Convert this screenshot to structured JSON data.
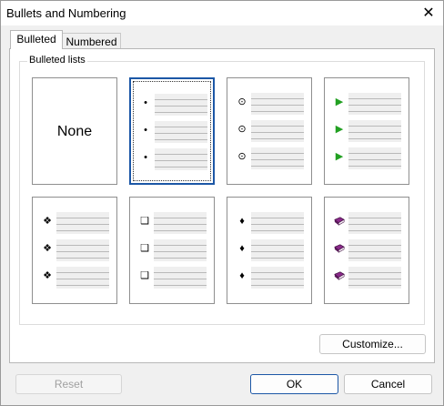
{
  "window": {
    "title": "Bullets and Numbering",
    "close_symbol": "✕"
  },
  "tabs": [
    {
      "label": "Bulleted",
      "active": true
    },
    {
      "label": "Numbered",
      "active": false
    }
  ],
  "group": {
    "label": "Bulleted lists",
    "styles": [
      {
        "kind": "none",
        "label": "None",
        "selected": false
      },
      {
        "kind": "small-dot",
        "glyph": "•",
        "icon": "dot-bullet-icon",
        "selected": true
      },
      {
        "kind": "circle-dot",
        "glyph": "⊙",
        "icon": "circled-dot-bullet-icon",
        "selected": false
      },
      {
        "kind": "green-arrow",
        "glyph": "▶",
        "icon": "green-arrow-bullet-icon",
        "color": "#22a022",
        "selected": false
      },
      {
        "kind": "four-diamonds",
        "glyph": "❖",
        "icon": "four-diamond-bullet-icon",
        "selected": false
      },
      {
        "kind": "square",
        "glyph": "❑",
        "icon": "square-bullet-icon",
        "selected": false
      },
      {
        "kind": "diamond",
        "glyph": "♦",
        "icon": "diamond-bullet-icon",
        "selected": false
      },
      {
        "kind": "book",
        "glyph": "book",
        "icon": "book-bullet-icon",
        "color": "#8a2a8a",
        "selected": false
      }
    ]
  },
  "buttons": {
    "customize": "Customize...",
    "reset": "Reset",
    "ok": "OK",
    "cancel": "Cancel"
  },
  "colors": {
    "selection": "#1c57a6",
    "titlebar": "#ffffff",
    "dialog_bg": "#f0f0f0"
  }
}
